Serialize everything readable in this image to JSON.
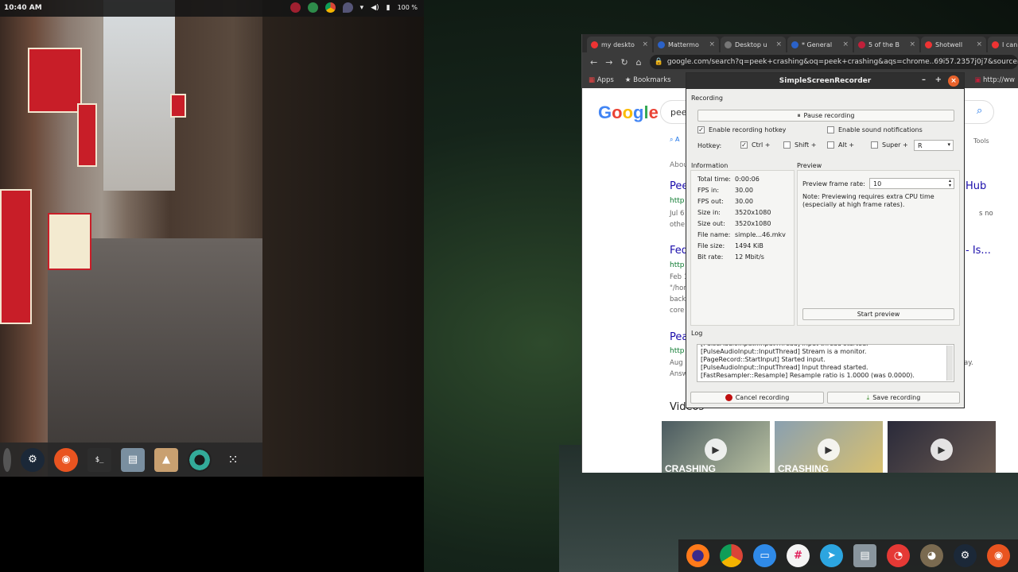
{
  "left_monitor": {
    "clock": "10:40 AM",
    "battery": "100 %",
    "dock_icons": [
      "terminal-icon",
      "steam-icon",
      "ubuntu-icon",
      "terminal-icon",
      "files-icon",
      "gimp-icon",
      "camera-icon",
      "apps-grid-icon"
    ]
  },
  "browser": {
    "tabs": [
      {
        "label": "my deskto",
        "favicon": "#e33"
      },
      {
        "label": "Mattermo",
        "favicon": "#2b62c8"
      },
      {
        "label": "Desktop u",
        "favicon": "#777"
      },
      {
        "label": "* General",
        "favicon": "#2b62c8"
      },
      {
        "label": "5 of the B",
        "favicon": "#c0203a"
      },
      {
        "label": "Shotwell",
        "favicon": "#e33"
      },
      {
        "label": "I can's",
        "favicon": "#e33"
      }
    ],
    "url": "google.com/search?q=peek+crashing&oq=peek+crashing&aqs=chrome..69i57.2357j0j7&sourceid=chrome",
    "bookmarks": {
      "apps": "Apps",
      "bookmarks": "Bookmarks",
      "extra": "http://ww"
    },
    "google": {
      "logo": "Google",
      "query": "peek",
      "tab_all": "A",
      "tools": "Tools",
      "about": "Abou",
      "results": [
        {
          "title": "Pee",
          "url": "http",
          "snip1": "Jul 6",
          "snip2": "othe",
          "right_title": "Hub",
          "right_snip": "s no"
        },
        {
          "title": "Fed",
          "url": "http",
          "snip1": "Feb 1",
          "snip2": "\"/hor",
          "snip3": "back",
          "snip4": "core",
          "right_title": "- Is...",
          "right_snip": ""
        },
        {
          "title": "Pea",
          "url": "http",
          "snip1": "Aug",
          "snip2": "Answ",
          "right_title": "",
          "right_snip": "ay."
        }
      ],
      "videos_label": "Videos",
      "video_caption": "CRASHING"
    }
  },
  "recorder": {
    "title": "SimpleScreenRecorder",
    "recording_section": "Recording",
    "pause_button": "Pause recording",
    "enable_hotkey": "Enable recording hotkey",
    "enable_sound": "Enable sound notifications",
    "hotkey_label": "Hotkey:",
    "ctrl": "Ctrl +",
    "shift": "Shift +",
    "alt": "Alt +",
    "super": "Super +",
    "key": "R",
    "information_section": "Information",
    "info": [
      {
        "k": "Total time:",
        "v": "0:00:06"
      },
      {
        "k": "FPS in:",
        "v": "30.00"
      },
      {
        "k": "FPS out:",
        "v": "30.00"
      },
      {
        "k": "Size in:",
        "v": "3520x1080"
      },
      {
        "k": "Size out:",
        "v": "3520x1080"
      },
      {
        "k": "File name:",
        "v": "simple...46.mkv"
      },
      {
        "k": "File size:",
        "v": "1494 KiB"
      },
      {
        "k": "Bit rate:",
        "v": "12 Mbit/s"
      }
    ],
    "preview_section": "Preview",
    "preview_rate_label": "Preview frame rate:",
    "preview_rate": "10",
    "preview_note": "Note: Previewing requires extra CPU time (especially at high frame rates).",
    "start_preview": "Start preview",
    "log_section": "Log",
    "log_lines": [
      "[PulseAudioInput::InputThread] Input thread started.",
      "[PulseAudioInput::InputThread] Stream is a monitor.",
      "[PageRecord::StartInput] Started input.",
      "[PulseAudioInput::InputThread] Input thread started.",
      "[FastResampler::Resample] Resample ratio is 1.0000 (was 0.0000)."
    ],
    "cancel": "Cancel recording",
    "save": "Save recording"
  },
  "right_dock_icons": [
    "firefox-icon",
    "chrome-icon",
    "messages-icon",
    "slack-icon",
    "telegram-icon",
    "files-icon",
    "pocketcasts-icon",
    "gimp-icon",
    "steam-icon",
    "ubuntu-icon"
  ]
}
